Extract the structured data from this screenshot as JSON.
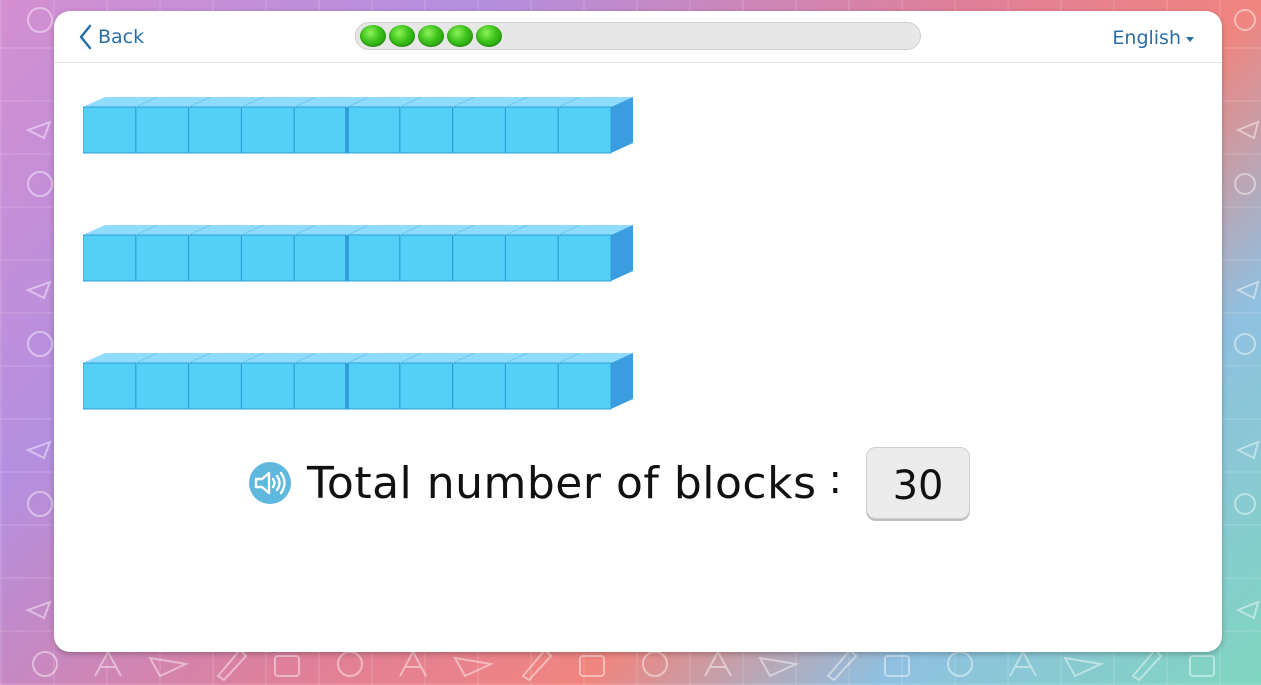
{
  "header": {
    "back_label": "Back",
    "language_label": "English",
    "progress_dots": 5
  },
  "blocks": {
    "rows": 3,
    "units_per_row": 10,
    "color_top": "#8fdcff",
    "color_front": "#54cff8",
    "color_side": "#3a9ee0"
  },
  "question": {
    "prompt": "Total number of blocks",
    "colon": ":",
    "answer": "30"
  }
}
